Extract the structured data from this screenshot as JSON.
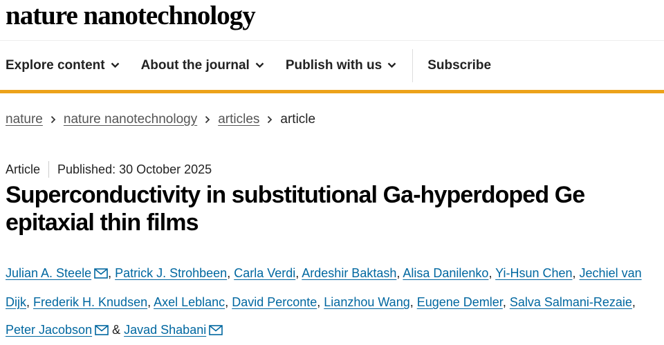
{
  "journal": {
    "name": "nature nanotechnology"
  },
  "nav": {
    "items": [
      {
        "label": "Explore content"
      },
      {
        "label": "About the journal"
      },
      {
        "label": "Publish with us"
      }
    ],
    "subscribe": "Subscribe"
  },
  "breadcrumb": {
    "items": [
      "nature",
      "nature nanotechnology",
      "articles"
    ],
    "current": "article"
  },
  "article": {
    "type": "Article",
    "published": "Published: 30 October 2025",
    "title": "Superconductivity in substitutional Ga-hyperdoped Ge epitaxial thin films",
    "authors": [
      "Julian A. Steele",
      "Patrick J. Strohbeen",
      "Carla Verdi",
      "Ardeshir Baktash",
      "Alisa Danilenko",
      "Yi-Hsun Chen",
      "Jechiel van Dijk",
      "Frederik H. Knudsen",
      "Axel Leblanc",
      "David Perconte",
      "Lianzhou Wang",
      "Eugene Demler",
      "Salva Salmani-Rezaie",
      "Peter Jacobson",
      "Javad Shabani"
    ],
    "ampersand": "&"
  },
  "colors": {
    "accent": "#eca21a",
    "link": "#0067a0"
  },
  "icons": {
    "chevron": "chevron-down-icon",
    "separator": "chevron-right-icon",
    "email": "email-icon"
  }
}
